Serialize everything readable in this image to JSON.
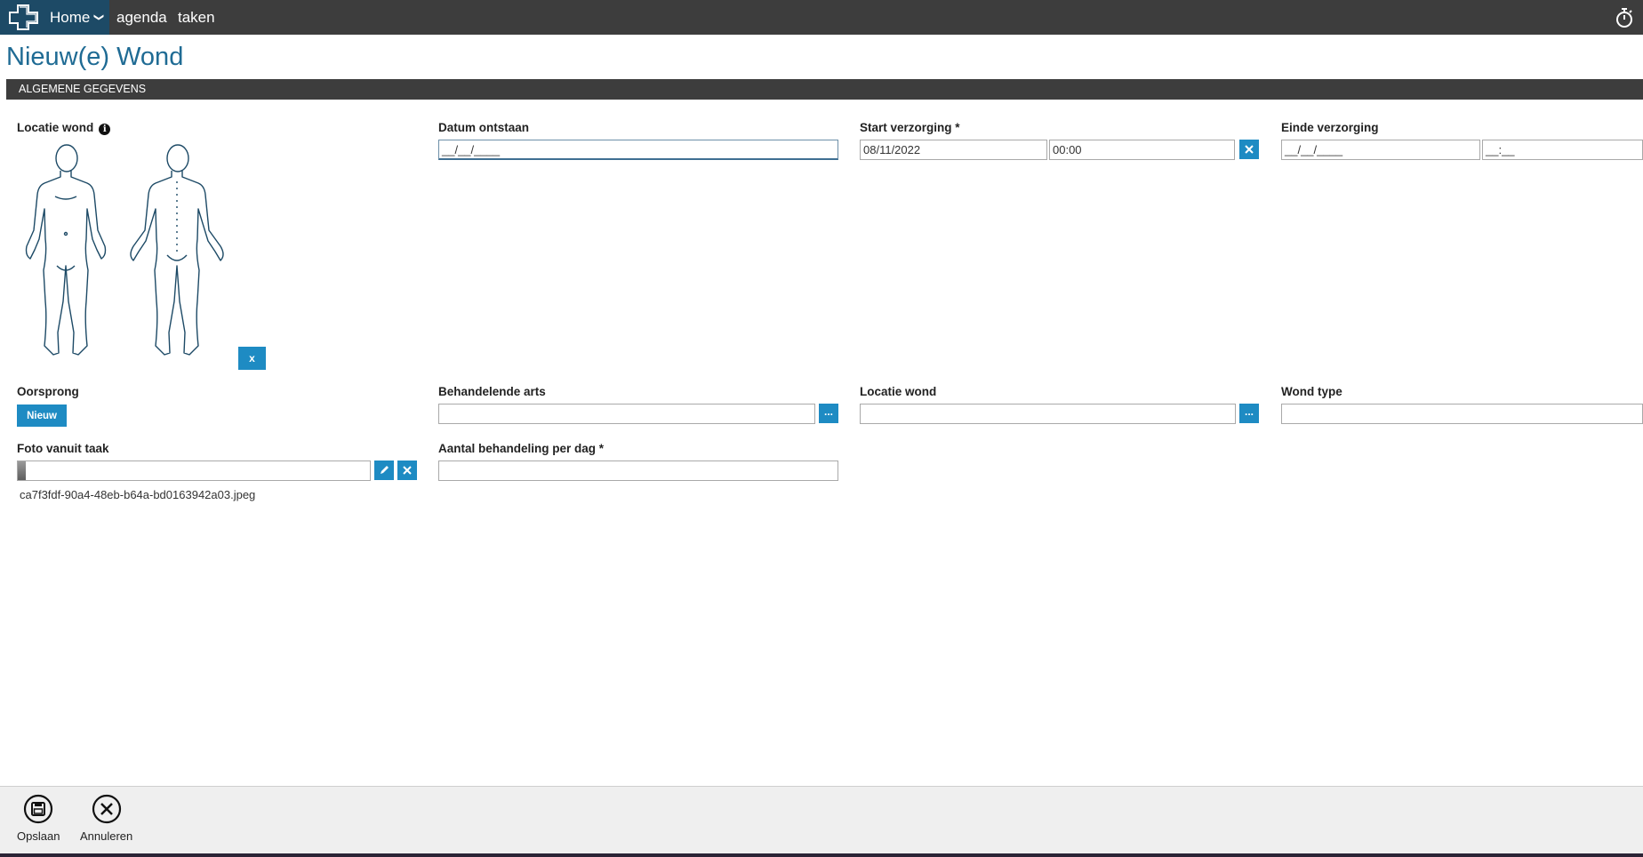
{
  "topbar": {
    "home_label": "Home",
    "nav": [
      "agenda",
      "taken"
    ],
    "logo_icon": "medical-cross-logo-icon",
    "timer_icon": "stopwatch-icon"
  },
  "page": {
    "title": "Nieuw(e) Wond"
  },
  "section": {
    "title": "ALGEMENE GEGEVENS"
  },
  "fields": {
    "locatie_wond_body": {
      "label": "Locatie wond",
      "clear_label": "x"
    },
    "datum_ontstaan": {
      "label": "Datum ontstaan",
      "value": "__/__/____"
    },
    "start_verzorging": {
      "label": "Start verzorging *",
      "date": "08/11/2022",
      "time": "00:00"
    },
    "einde_verzorging": {
      "label": "Einde verzorging",
      "date": "__/__/____",
      "time": "__:__"
    },
    "oorsprong": {
      "label": "Oorsprong",
      "button": "Nieuw"
    },
    "behandelende_arts": {
      "label": "Behandelende arts",
      "value": "",
      "lookup": "..."
    },
    "locatie_wond": {
      "label": "Locatie wond",
      "value": "",
      "lookup": "..."
    },
    "wond_type": {
      "label": "Wond type",
      "value": ""
    },
    "foto_vanuit_taak": {
      "label": "Foto vanuit taak",
      "filename": "ca7f3fdf-90a4-48eb-b64a-bd0163942a03.jpeg"
    },
    "aantal_behandeling": {
      "label": "Aantal behandeling per dag *",
      "value": ""
    }
  },
  "actions": {
    "save": "Opslaan",
    "cancel": "Annuleren"
  },
  "colors": {
    "accent": "#1e8bc3",
    "title": "#1f6b94",
    "topbar": "#3d3d3d",
    "logo_bg": "#1d4a66"
  }
}
